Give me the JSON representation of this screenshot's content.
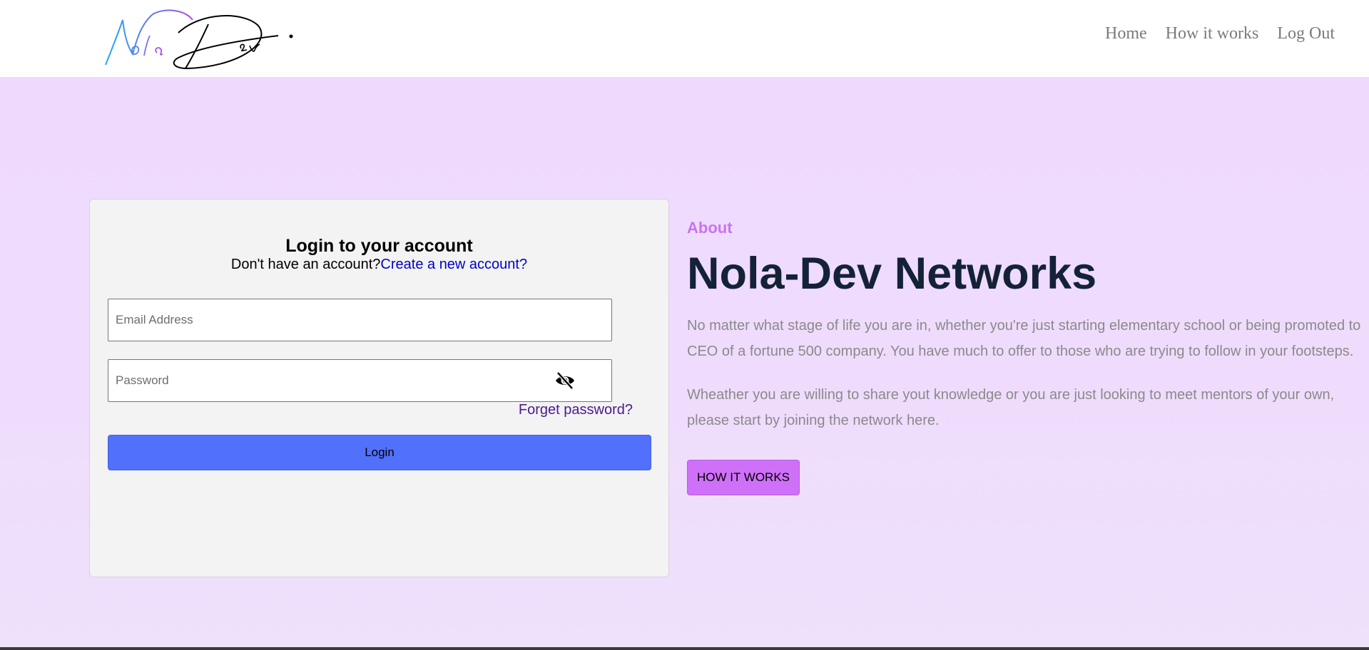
{
  "header": {
    "logo": {
      "primary_word": "Nola",
      "secondary_word": "Dev"
    },
    "nav": [
      {
        "label": "Home"
      },
      {
        "label": "How it works"
      },
      {
        "label": "Log Out"
      }
    ]
  },
  "login": {
    "title": "Login to your account",
    "no_account_text": "Don't have an account?",
    "create_link": "Create a new account?",
    "email_placeholder": "Email Address",
    "password_placeholder": "Password",
    "password_toggle_icon": "eye-slash-icon",
    "forget_link": "Forget password?",
    "login_button": "Login"
  },
  "about": {
    "kicker": "About",
    "title": "Nola-Dev Networks",
    "paragraph1": "No matter what stage of life you are in, whether you're just starting elementary school or being promoted to CEO of a fortune 500 company. You have much to offer to those who are trying to follow in your footsteps.",
    "paragraph2": "Wheather you are willing to share yout knowledge or you are just looking to meet mentors of your own, please start by joining the network here.",
    "button": "HOW IT WORKS"
  },
  "colors": {
    "hero_background": "#efdafd",
    "login_button": "#5170fb",
    "how_button": "#cf70f8",
    "kicker": "#c874f0",
    "title": "#142238",
    "link": "#0000cc"
  }
}
